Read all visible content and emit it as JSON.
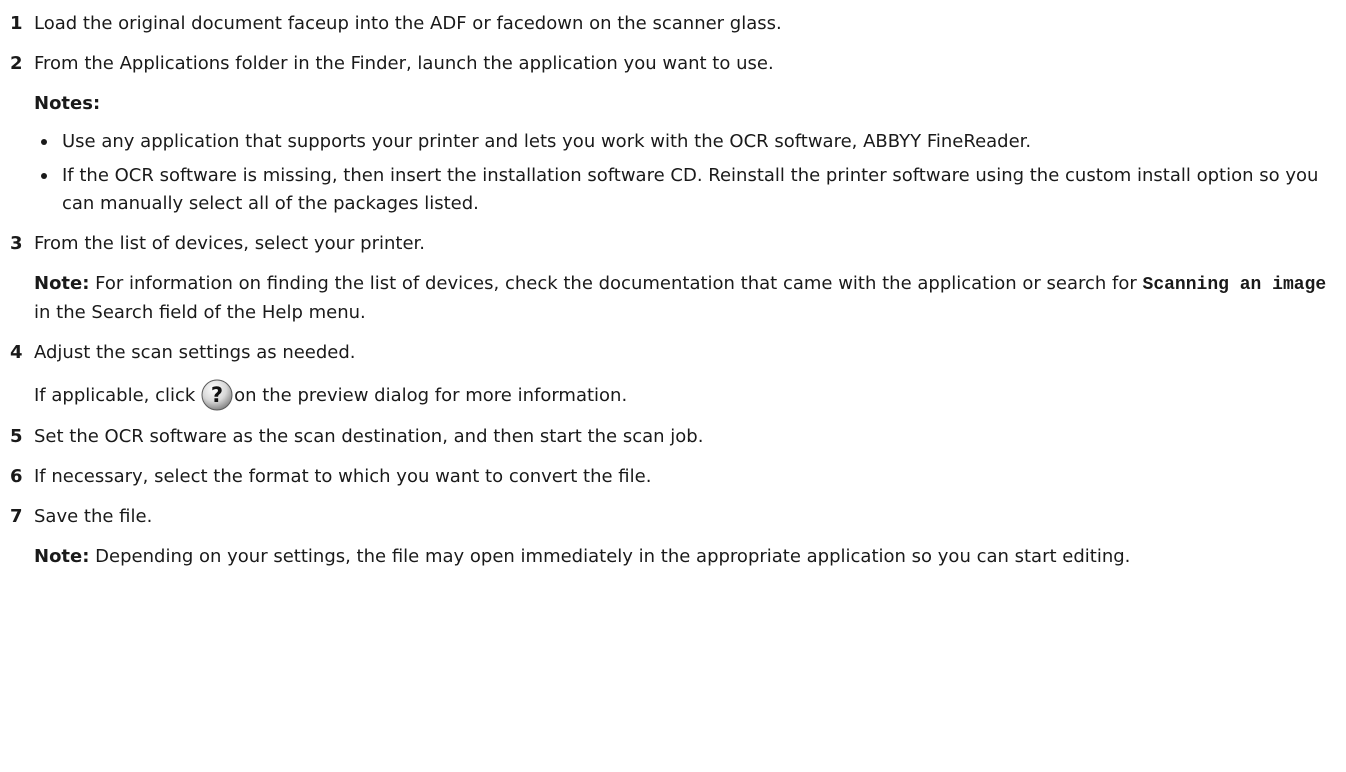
{
  "steps": [
    {
      "num": "1",
      "text": "Load the original document faceup into the ADF or facedown on the scanner glass."
    },
    {
      "num": "2",
      "text": "From the Applications folder in the Finder, launch the application you want to use.",
      "notes_title": "Notes:",
      "bullets": [
        "Use any application that supports your printer and lets you work with the OCR software, ABBYY FineReader.",
        "If the OCR software is missing, then insert the installation software CD. Reinstall the printer software using the custom install option so you can manually select all of the packages listed."
      ]
    },
    {
      "num": "3",
      "text": "From the list of devices, select your printer.",
      "note_label": "Note:",
      "note_text_before": " For information on finding the list of devices, check the documentation that came with the application or search for ",
      "note_code": "Scanning an image",
      "note_text_after": " in the Search field of the Help menu."
    },
    {
      "num": "4",
      "text": "Adjust the scan settings as needed.",
      "sub_before": "If applicable, click ",
      "sub_icon": "help-question-icon",
      "sub_after": "on the preview dialog for more information."
    },
    {
      "num": "5",
      "text": "Set the OCR software as the scan destination, and then start the scan job."
    },
    {
      "num": "6",
      "text": "If necessary, select the format to which you want to convert the file."
    },
    {
      "num": "7",
      "text": "Save the file.",
      "note_label": "Note:",
      "note_text": " Depending on your settings, the file may open immediately in the appropriate application so you can start editing."
    }
  ]
}
